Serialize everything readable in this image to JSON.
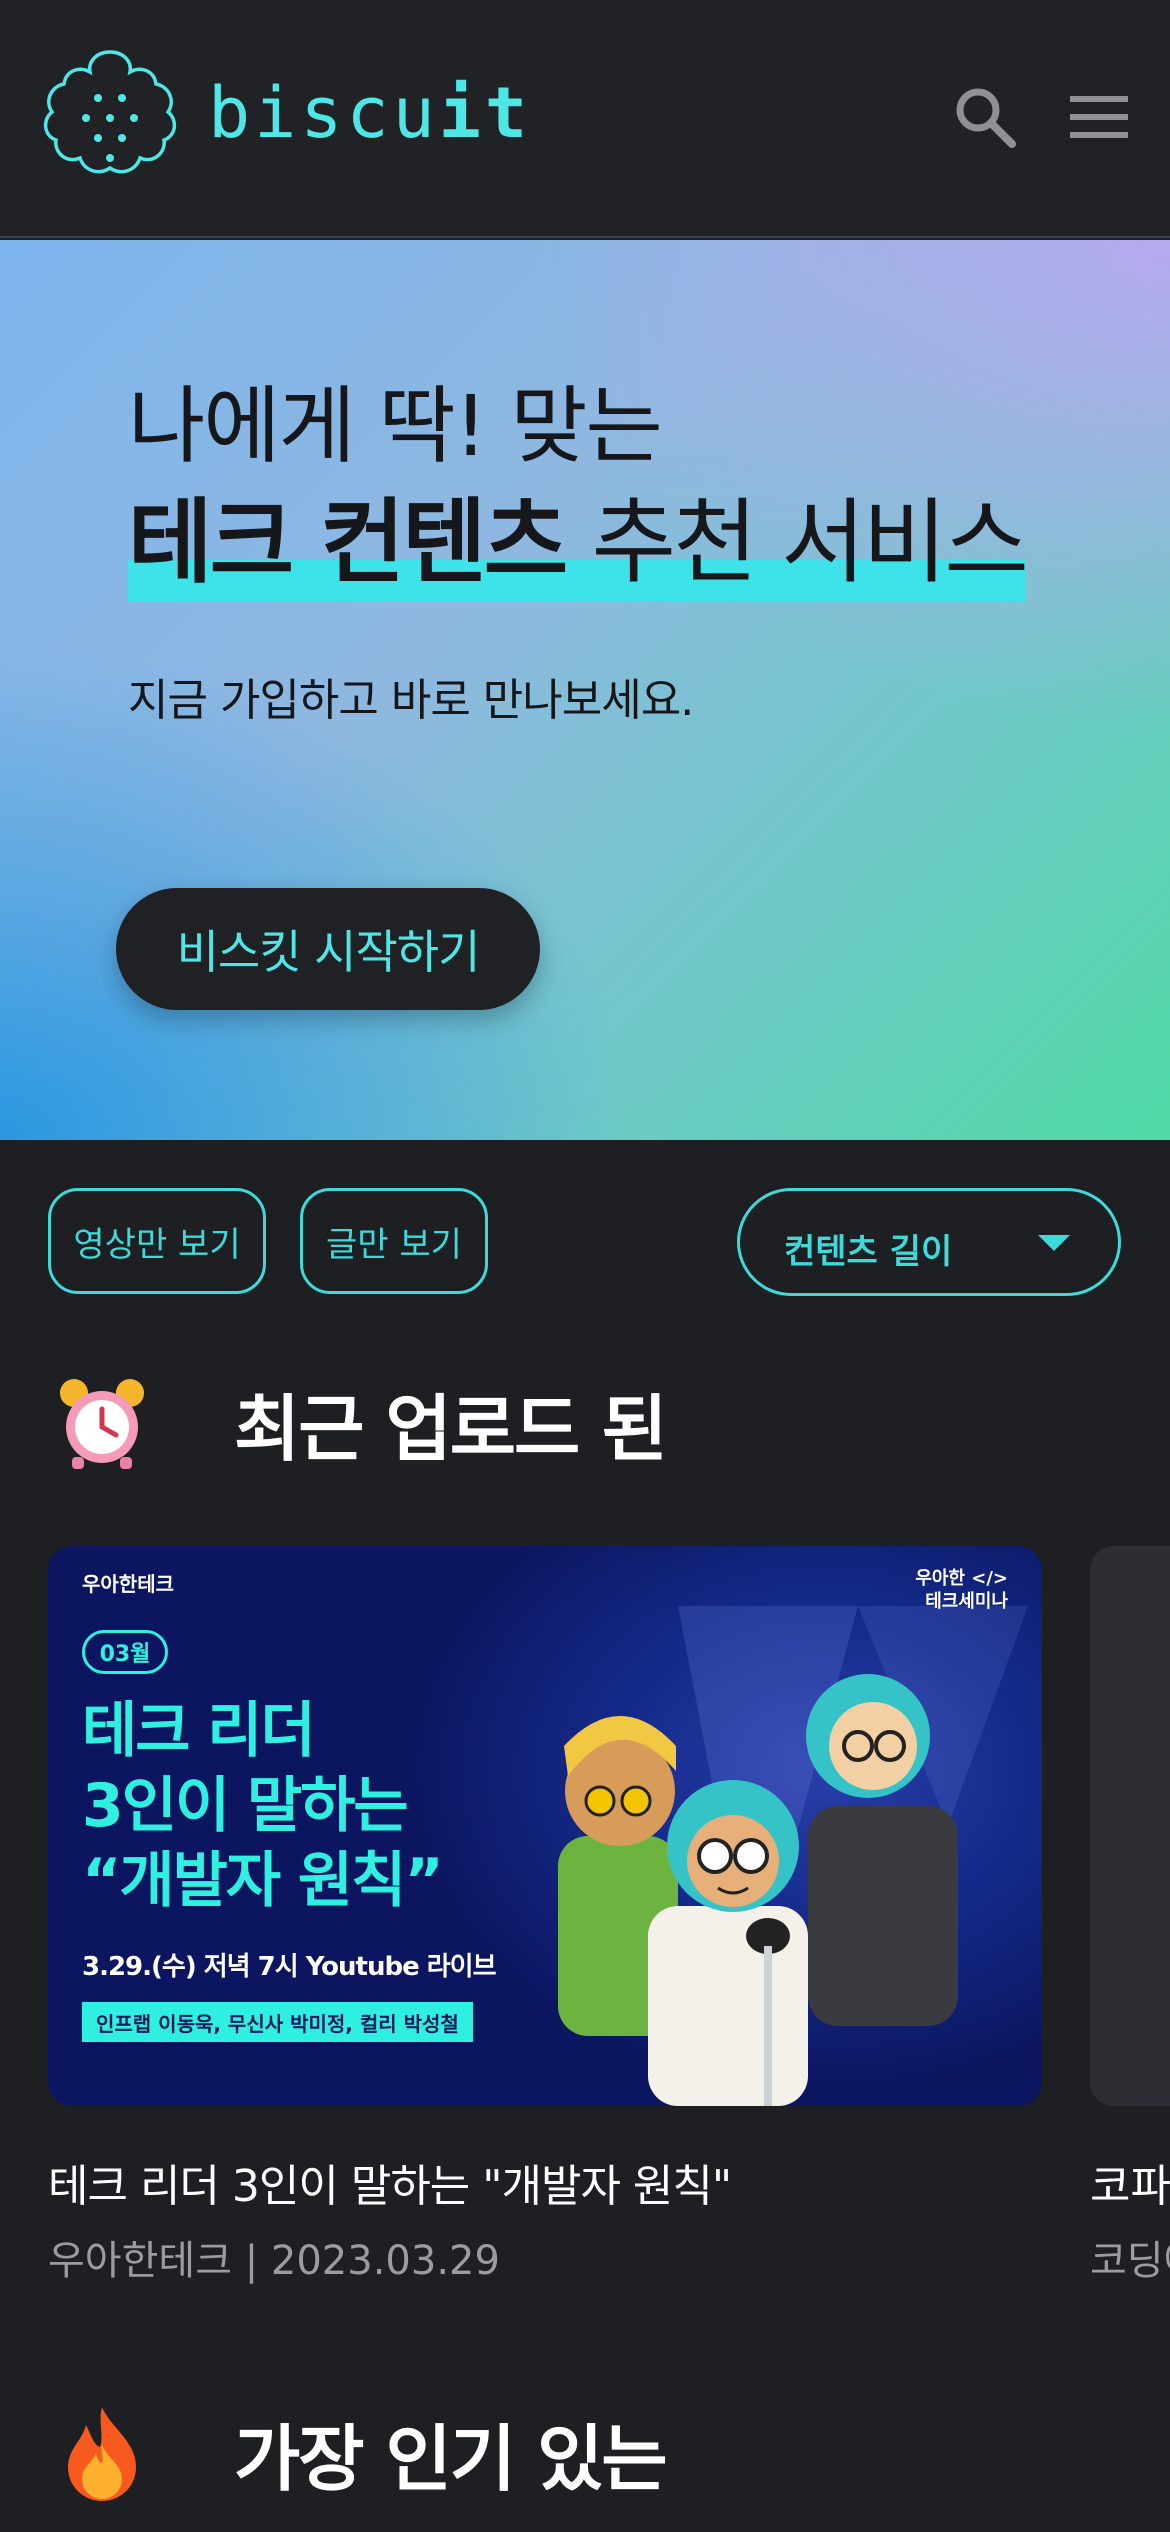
{
  "header": {
    "brand_prefix": "biscu",
    "brand_suffix": "it",
    "search_icon": "search-icon",
    "menu_icon": "hamburger-menu-icon",
    "accent_color": "#4ee6e6"
  },
  "hero": {
    "line1": "나에게 딱! 맞는",
    "line2_bold": "테크 컨텐츠",
    "line2_rest": " 추천 서비스",
    "subtitle": "지금 가입하고 바로 만나보세요.",
    "cta_label": "비스킷 시작하기"
  },
  "filters": {
    "video_only": "영상만 보기",
    "text_only": "글만 보기",
    "length_dropdown": "컨텐츠 길이"
  },
  "sections": {
    "recent": {
      "icon": "alarm-clock-icon",
      "title": "최근 업로드 된"
    },
    "popular": {
      "icon": "fire-icon",
      "title": "가장 인기 있는"
    }
  },
  "cards": [
    {
      "title": "테크 리더 3인이 말하는 \"개발자 원칙\"",
      "meta": "우아한테크 | 2023.03.29",
      "thumbnail": {
        "brand": "우아한테크",
        "seminar_line1": "우아한 </>",
        "seminar_line2": "테크세미나",
        "month_badge": "03월",
        "headline_line1": "테크 리더",
        "headline_line2": "3인이 말하는",
        "headline_line3": "“개발자 원칙”",
        "date": "3.29.(수) 저녁 7시 Youtube 라이브",
        "speakers": "인프랩 이동욱, 무신사 박미정, 컬리 박성철"
      }
    },
    {
      "title": "코파",
      "meta": "코딩애"
    }
  ]
}
